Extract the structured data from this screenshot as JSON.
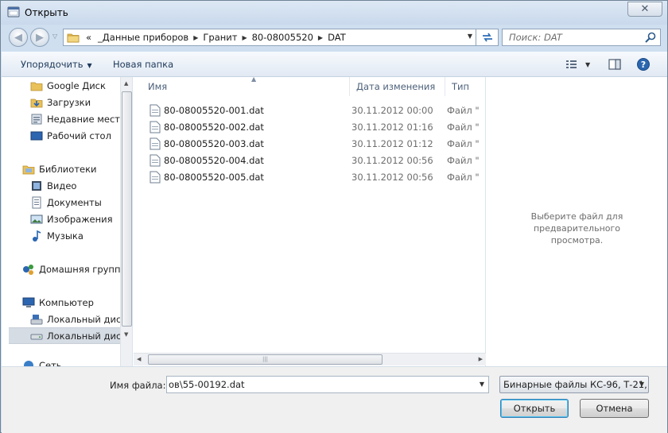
{
  "window": {
    "title": "Открыть",
    "close_symbol": "✕"
  },
  "address": {
    "overflow": "«",
    "crumbs": [
      "_Данные приборов",
      "Гранит",
      "80-08005520",
      "DAT"
    ],
    "search_placeholder": "Поиск: DAT"
  },
  "toolbar": {
    "organize_label": "Упорядочить",
    "new_folder_label": "Новая папка"
  },
  "nav": {
    "items": [
      {
        "label": "Google Диск",
        "icon": "folder-icon"
      },
      {
        "label": "Загрузки",
        "icon": "downloads-icon"
      },
      {
        "label": "Недавние места",
        "icon": "recent-places-icon"
      },
      {
        "label": "Рабочий стол",
        "icon": "desktop-icon"
      },
      {
        "label": "Библиотеки",
        "icon": "libraries-icon"
      },
      {
        "label": "Видео",
        "icon": "video-icon"
      },
      {
        "label": "Документы",
        "icon": "documents-icon"
      },
      {
        "label": "Изображения",
        "icon": "pictures-icon"
      },
      {
        "label": "Музыка",
        "icon": "music-icon"
      },
      {
        "label": "Домашняя группа",
        "icon": "homegroup-icon"
      },
      {
        "label": "Компьютер",
        "icon": "computer-icon"
      },
      {
        "label": "Локальный диск",
        "icon": "local-disk-icon"
      },
      {
        "label": "Локальный диск",
        "icon": "local-disk-icon"
      },
      {
        "label": "Сеть",
        "icon": "network-icon"
      }
    ]
  },
  "filelist": {
    "columns": {
      "name": "Имя",
      "date": "Дата изменения",
      "type": "Тип"
    },
    "rows": [
      {
        "name": "80-08005520-001.dat",
        "date": "30.11.2012 00:00",
        "type": "Файл \"D"
      },
      {
        "name": "80-08005520-002.dat",
        "date": "30.11.2012 01:16",
        "type": "Файл \"D"
      },
      {
        "name": "80-08005520-003.dat",
        "date": "30.11.2012 01:12",
        "type": "Файл \"D"
      },
      {
        "name": "80-08005520-004.dat",
        "date": "30.11.2012 00:56",
        "type": "Файл \"D"
      },
      {
        "name": "80-08005520-005.dat",
        "date": "30.11.2012 00:56",
        "type": "Файл \"D"
      }
    ]
  },
  "preview": {
    "message_line1": "Выберите файл для предварительного",
    "message_line2": "просмотра."
  },
  "bottom": {
    "filename_label": "Имя файла:",
    "filename_value": "ов\\55-00192.dat",
    "filter_value": "Бинарные файлы КС-96, Т-21,",
    "open_label": "Открыть",
    "cancel_label": "Отмена"
  },
  "colors": {
    "accent": "#3c7fb1",
    "frame": "#cfdff0",
    "link_text": "#1e395b"
  }
}
